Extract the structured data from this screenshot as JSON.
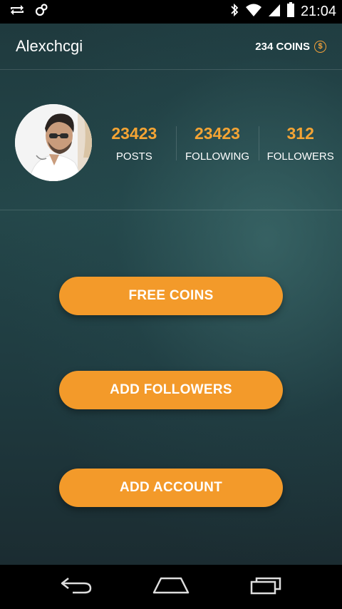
{
  "status_bar": {
    "time": "21:04"
  },
  "header": {
    "username": "Alexchcgi",
    "coins_label": "234 COINS",
    "coin_symbol": "$"
  },
  "profile": {
    "stats": [
      {
        "value": "23423",
        "label": "POSTS"
      },
      {
        "value": "23423",
        "label": "FOLLOWING"
      },
      {
        "value": "312",
        "label": "FOLLOWERS"
      }
    ]
  },
  "actions": {
    "free_coins": "FREE COINS",
    "add_followers": "ADD FOLLOWERS",
    "add_account": "ADD ACCOUNT"
  },
  "colors": {
    "accent": "#f39a2a",
    "stat_value": "#f4a434",
    "background": "#1f3a3e"
  },
  "icons": {
    "status_left": [
      "sync-icon",
      "link-icon"
    ],
    "status_right": [
      "bluetooth-icon",
      "wifi-icon",
      "signal-icon",
      "battery-icon"
    ],
    "nav": [
      "back-icon",
      "home-icon",
      "recent-apps-icon"
    ]
  }
}
